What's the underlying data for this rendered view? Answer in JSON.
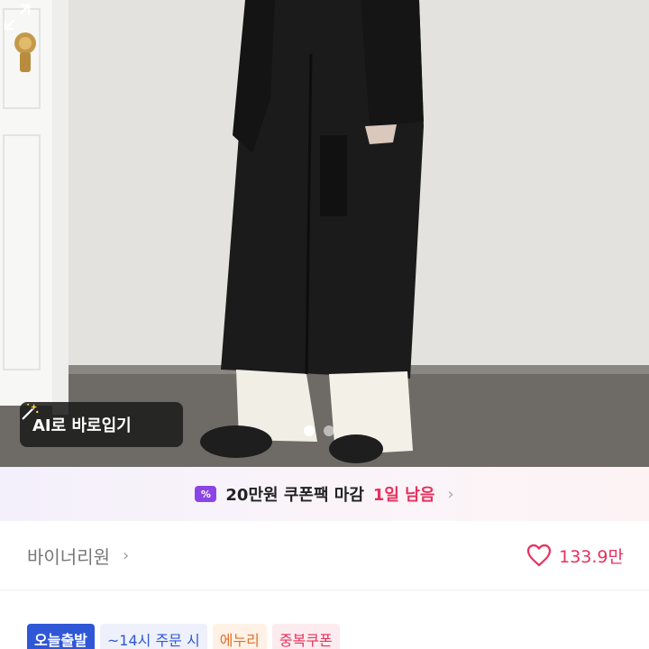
{
  "gallery": {
    "ai_button_label": "AI로 바로입기",
    "page_dots": 2,
    "active_dot": 1
  },
  "coupon_bar": {
    "icon_text": "%",
    "text": "20만원 쿠폰팩 마감",
    "remaining": "1일 남음",
    "chevron": "›"
  },
  "seller": {
    "name": "바이너리원",
    "chevron": "›"
  },
  "likes": {
    "count": "133.9만"
  },
  "badges": [
    {
      "label": "오늘출발"
    },
    {
      "label": "~14시 주문 시"
    },
    {
      "label": "에누리"
    },
    {
      "label": "중복쿠폰"
    }
  ],
  "colors": {
    "accent_pink": "#e8305d",
    "accent_purple": "#8b45e6",
    "delivery_blue": "#2f57d6"
  }
}
